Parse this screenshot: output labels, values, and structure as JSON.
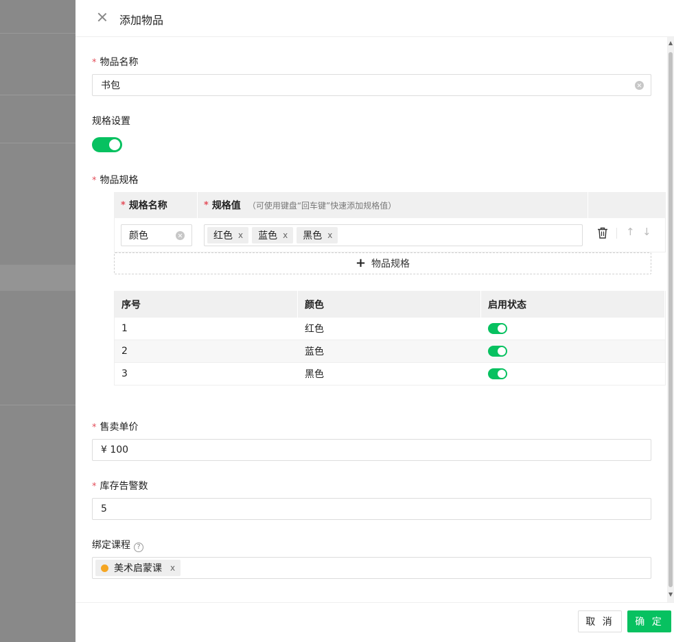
{
  "drawer": {
    "title": "添加物品"
  },
  "form": {
    "item_name": {
      "label": "物品名称",
      "required": "*",
      "value": "书包"
    },
    "spec_setting": {
      "label": "规格设置",
      "enabled": true
    },
    "item_spec": {
      "label": "物品规格",
      "required": "*"
    },
    "spec_table": {
      "col_name": "规格名称",
      "col_value": "规格值",
      "col_value_hint": "（可使用键盘“回车键”快速添加规格值）",
      "row": {
        "name": "颜色",
        "values": [
          "红色",
          "蓝色",
          "黑色"
        ],
        "remove_glyph": "x"
      },
      "add_button": "物品规格"
    },
    "status_table": {
      "headers": [
        "序号",
        "颜色",
        "启用状态"
      ],
      "rows": [
        {
          "index": "1",
          "color": "红色",
          "enabled": true
        },
        {
          "index": "2",
          "color": "蓝色",
          "enabled": true
        },
        {
          "index": "3",
          "color": "黑色",
          "enabled": true
        }
      ]
    },
    "unit_price": {
      "label": "售卖单价",
      "required": "*",
      "value": "¥ 100"
    },
    "stock_alert": {
      "label": "库存告警数",
      "required": "*",
      "value": "5"
    },
    "bind_course": {
      "label": "绑定课程",
      "help": "?",
      "tag": "美术启蒙课",
      "tag_color": "#f5a623",
      "remove_glyph": "x"
    }
  },
  "footer": {
    "cancel": "取 消",
    "confirm": "确 定"
  },
  "colors": {
    "accent": "#07c160",
    "required": "#e34d59"
  }
}
